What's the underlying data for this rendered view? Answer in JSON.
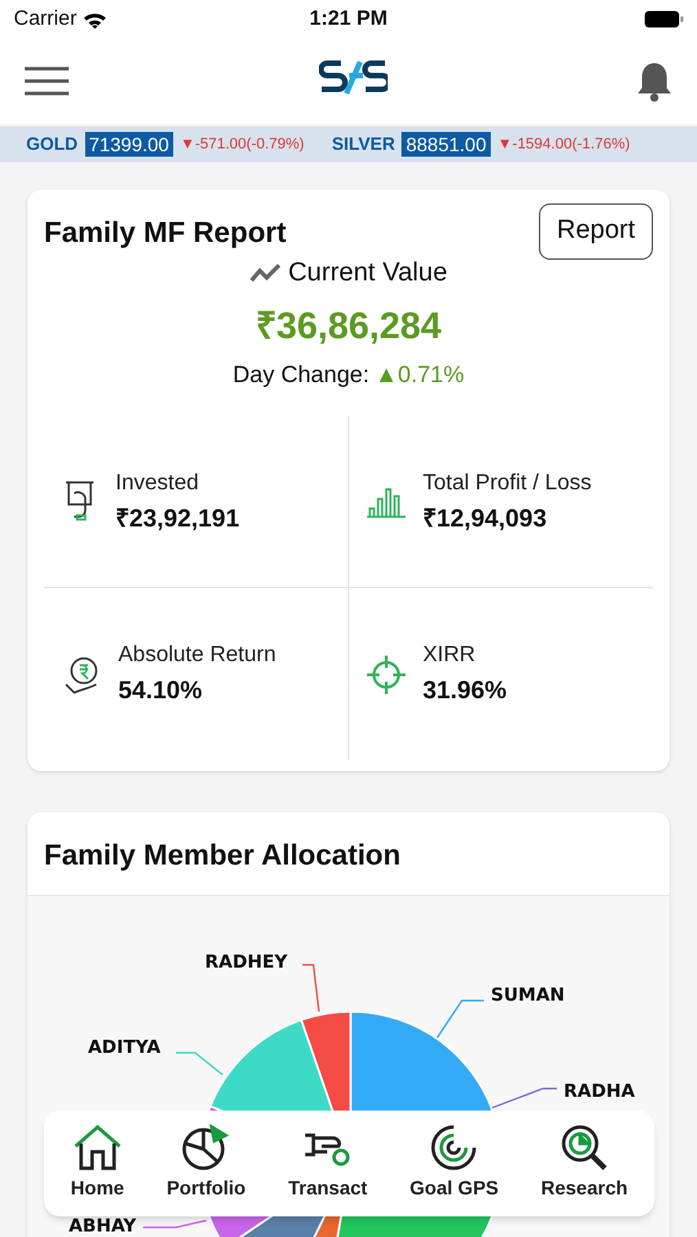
{
  "status_bar": {
    "carrier": "Carrier",
    "time": "1:21 PM"
  },
  "ticker": [
    {
      "name": "GOLD",
      "price": "71399.00",
      "change": "-571.00(-0.79%)",
      "arrow": "▼",
      "color": "#d93a3a"
    },
    {
      "name": "SILVER",
      "price": "88851.00",
      "change": "-1594.00(-1.76%)",
      "arrow": "▼",
      "color": "#d93a3a"
    }
  ],
  "report_card": {
    "title": "Family MF Report",
    "button": "Report",
    "current_value_label": "Current Value",
    "current_value": "₹36,86,284",
    "day_change_label": "Day Change:",
    "day_change": "0.71%",
    "day_change_arrow": "▲",
    "stats": [
      {
        "kind": "invested",
        "label": "Invested",
        "value": "₹23,92,191"
      },
      {
        "kind": "profit",
        "label": "Total Profit / Loss",
        "value": "₹12,94,093"
      },
      {
        "kind": "return",
        "label": "Absolute Return",
        "value": "54.10%"
      },
      {
        "kind": "xirr",
        "label": "XIRR",
        "value": "31.96%"
      }
    ]
  },
  "allocation_card": {
    "title": "Family Member Allocation",
    "slices": [
      {
        "label": "SUMAN",
        "color": "#33aaf5"
      },
      {
        "label": "RADHA",
        "color": "#7b68d8"
      },
      {
        "label": "ABHAY",
        "color": "#c865e8"
      },
      {
        "label": "ADITYA",
        "color": "#3ddbc5"
      },
      {
        "label": "RADHEY",
        "color": "#f44b45"
      }
    ]
  },
  "bottom_nav": [
    {
      "kind": "home",
      "label": "Home"
    },
    {
      "kind": "portfolio",
      "label": "Portfolio"
    },
    {
      "kind": "transact",
      "label": "Transact"
    },
    {
      "kind": "goal",
      "label": "Goal GPS"
    },
    {
      "kind": "research",
      "label": "Research"
    }
  ]
}
